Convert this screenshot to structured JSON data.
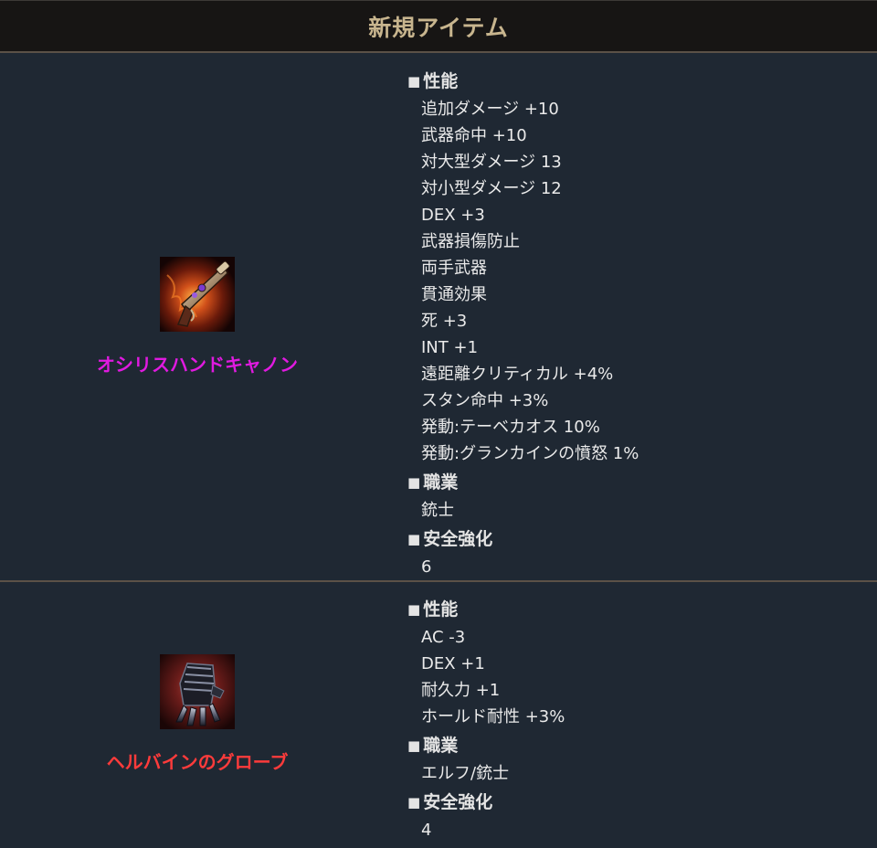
{
  "header": {
    "title": "新規アイテム"
  },
  "colors": {
    "item1_name": "#e01ae0",
    "item2_name": "#ff3b3b",
    "panel_bg": "#1f2833",
    "header_bg": "#171514",
    "header_text": "#c8b58e"
  },
  "section_labels": {
    "bullet": "■",
    "performance": "性能",
    "class": "職業",
    "safe_enchant": "安全強化"
  },
  "items": [
    {
      "name": "オシリスハンドキャノン",
      "icon": "hand-cannon-icon",
      "performance": [
        "追加ダメージ +10",
        "武器命中 +10",
        "対大型ダメージ 13",
        "対小型ダメージ 12",
        "DEX +3",
        "武器損傷防止",
        "両手武器",
        "貫通効果",
        "死 +3",
        "INT +1",
        "遠距離クリティカル +4%",
        "スタン命中 +3%",
        "発動:テーベカオス 10%",
        "発動:グランカインの憤怒 1%"
      ],
      "class": "銃士",
      "safe_enchant": "6"
    },
    {
      "name": "ヘルバインのグローブ",
      "icon": "glove-icon",
      "performance": [
        "AC -3",
        "DEX +1",
        "耐久力 +1",
        "ホールド耐性 +3%"
      ],
      "class": "エルフ/銃士",
      "safe_enchant": "4"
    }
  ]
}
